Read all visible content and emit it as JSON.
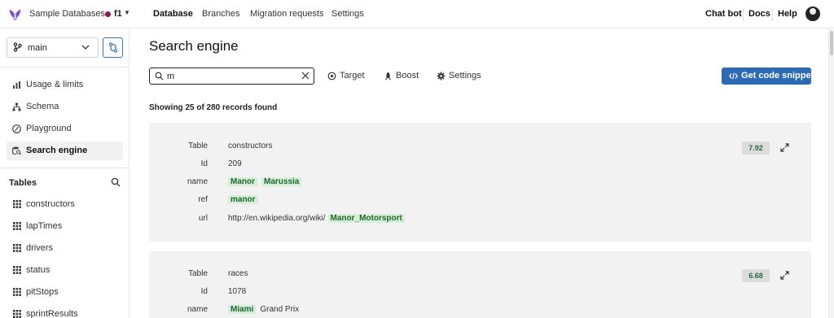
{
  "topbar": {
    "workspace": "Sample Databases",
    "database": "f1",
    "nav": [
      "Database",
      "Branches",
      "Migration requests",
      "Settings"
    ],
    "active_nav": "Database",
    "right_links": [
      "Chat bot",
      "Docs",
      "Help"
    ]
  },
  "sidebar": {
    "branch": "main",
    "items": [
      {
        "label": "Usage & limits",
        "icon": "bar-chart-icon"
      },
      {
        "label": "Schema",
        "icon": "schema-icon"
      },
      {
        "label": "Playground",
        "icon": "playground-icon"
      },
      {
        "label": "Search engine",
        "icon": "search-engine-icon",
        "active": true
      }
    ],
    "tables_title": "Tables",
    "tables": [
      "constructors",
      "lapTimes",
      "drivers",
      "status",
      "pitStops",
      "sprintResults"
    ]
  },
  "main": {
    "title": "Search engine",
    "search": {
      "value": "m",
      "placeholder": ""
    },
    "tools": {
      "target": "Target",
      "boost": "Boost",
      "settings": "Settings"
    },
    "snippet_button": "Get code snippet",
    "records_text": "Showing 25 of 280 records found",
    "results": [
      {
        "score": "7.92",
        "fields": [
          {
            "key": "Table",
            "parts": [
              {
                "t": "constructors",
                "h": false
              }
            ]
          },
          {
            "key": "Id",
            "parts": [
              {
                "t": "209",
                "h": false
              }
            ]
          },
          {
            "key": "name",
            "parts": [
              {
                "t": "Manor",
                "h": true
              },
              {
                "t": "Marussia",
                "h": true
              }
            ]
          },
          {
            "key": "ref",
            "parts": [
              {
                "t": "manor",
                "h": true
              }
            ]
          },
          {
            "key": "url",
            "parts": [
              {
                "t": "http://en.wikipedia.org/wiki/",
                "h": false
              },
              {
                "t": "Manor_Motorsport",
                "h": true
              }
            ]
          }
        ]
      },
      {
        "score": "6.68",
        "fields": [
          {
            "key": "Table",
            "parts": [
              {
                "t": "races",
                "h": false
              }
            ]
          },
          {
            "key": "Id",
            "parts": [
              {
                "t": "1078",
                "h": false
              }
            ]
          },
          {
            "key": "name",
            "parts": [
              {
                "t": "Miami",
                "h": true
              },
              {
                "t": "Grand Prix",
                "h": false
              }
            ]
          }
        ]
      }
    ]
  },
  "colors": {
    "accent": "#2c6ab3",
    "db_dot": "#8a1c5a",
    "highlight_bg": "#d7ecd9",
    "highlight_fg": "#1d6b2f",
    "card_bg": "#f2f2f2"
  }
}
